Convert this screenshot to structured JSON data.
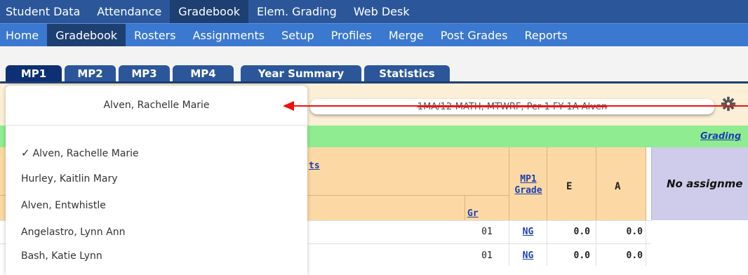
{
  "top_nav": {
    "items": [
      "Student Data",
      "Attendance",
      "Gradebook",
      "Elem. Grading",
      "Web Desk"
    ],
    "active_index": 2
  },
  "sub_nav": {
    "items": [
      "Home",
      "Gradebook",
      "Rosters",
      "Assignments",
      "Setup",
      "Profiles",
      "Merge",
      "Post Grades",
      "Reports"
    ],
    "active_index": 1
  },
  "tabs": {
    "items": [
      "MP1",
      "MP2",
      "MP3",
      "MP4",
      "Year Summary",
      "Statistics"
    ],
    "active_index": 0
  },
  "course_label": "1MA/12-MATH, MTWRF, Per 1 FY 1A-Alven",
  "grading_link": "Grading",
  "student_dropdown": {
    "selected": "Alven, Rachelle Marie",
    "options": [
      "Alven, Rachelle Marie",
      "Hurley, Kaitlin Mary",
      "Alven, Entwhistle",
      "Angelastro, Lynn Ann",
      "Bash, Katie Lynn"
    ],
    "checked_index": 0
  },
  "grade_table": {
    "partial_header": "ts",
    "mp1_grade_header": "MP1 Grade",
    "mp1_line1": "MP1",
    "mp1_line2": "Grade",
    "gr_header": "Gr",
    "e_header": "E",
    "a_header": "A",
    "rows": [
      {
        "gr": "01",
        "mp1": "NG",
        "e": "0.0",
        "a": "0.0"
      },
      {
        "gr": "01",
        "mp1": "NG",
        "e": "0.0",
        "a": "0.0"
      }
    ]
  },
  "no_assignments_text": "No assignme",
  "colors": {
    "top_nav_bg": "#2b579a",
    "sub_nav_bg": "#3b78d0",
    "active_nav_bg": "#1d3f72",
    "tab_bg": "#2b579a",
    "info_bar_bg": "#fbefd7",
    "green_bar_bg": "#90ec90",
    "grade_header_bg": "#fcd9a4",
    "no_assign_bg": "#cfcbea",
    "annotation_arrow": "#ee1111",
    "link_color": "#1a3fb0"
  },
  "icons": {
    "settings": "gear-icon",
    "annotation": "red-arrow-annotation",
    "check": "checkmark-icon"
  }
}
